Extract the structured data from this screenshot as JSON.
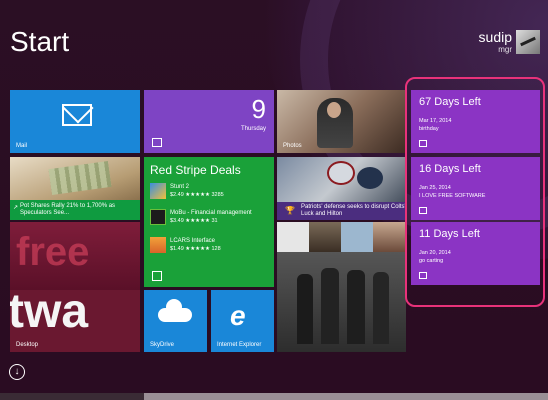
{
  "screen": {
    "title": "Start"
  },
  "user": {
    "name": "sudip",
    "sub": "mgr"
  },
  "tiles": {
    "mail": {
      "label": "Mail"
    },
    "calendar": {
      "day_number": "9",
      "day_name": "Thursday"
    },
    "photos": {
      "label": "Photos"
    },
    "finance": {
      "headline": "Pot Shares Rally 21% to 1,700% as Speculators See..."
    },
    "store": {
      "title": "Red Stripe Deals",
      "apps": [
        {
          "name": "Stunt 2",
          "price": "$2.49 ★★★★★ 3285"
        },
        {
          "name": "MoBu - Financial management",
          "price": "$3.49 ★★★★★ 31"
        },
        {
          "name": "LCARS Interface",
          "price": "$1.49 ★★★★★ 128"
        }
      ]
    },
    "sports": {
      "headline": "Patriots' defense seeks to disrupt Colts' Luck and Hilton"
    },
    "desktop": {
      "label": "Desktop",
      "word1": "free",
      "word2": "twa"
    },
    "skydrive": {
      "label": "SkyDrive"
    },
    "ie": {
      "label": "Internet Explorer"
    }
  },
  "days_left": [
    {
      "title": "67 Days Left",
      "date": "Mar 17, 2014",
      "note": "birthday"
    },
    {
      "title": "16 Days Left",
      "date": "Jan 25, 2014",
      "note": "I LOVE FREE SOFTWARE"
    },
    {
      "title": "11 Days Left",
      "date": "Jan 20, 2014",
      "note": "go carting"
    }
  ],
  "colors": {
    "accent_blue": "#1a87d8",
    "green": "#1aa139",
    "purple_tile": "#8b34c4",
    "highlight": "#e8327a"
  },
  "icons": {
    "apps_down": "down-arrow-icon"
  }
}
